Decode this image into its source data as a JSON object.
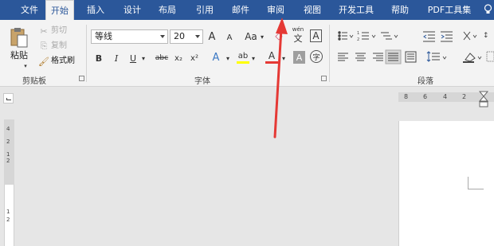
{
  "tabs": [
    "文件",
    "开始",
    "插入",
    "设计",
    "布局",
    "引用",
    "邮件",
    "审阅",
    "视图",
    "开发工具",
    "帮助",
    "PDF工具集"
  ],
  "active_tab": "开始",
  "clipboard": {
    "paste": "粘贴",
    "cut": "剪切",
    "copy": "复制",
    "format_painter": "格式刷",
    "group_label": "剪贴板"
  },
  "font": {
    "font_name": "等线",
    "font_size": "20",
    "group_label": "字体",
    "grow": "A",
    "shrink": "A",
    "case": "Aa",
    "bold": "B",
    "italic": "I",
    "underline": "U",
    "strike": "abc",
    "subscript": "x₂",
    "superscript": "x²",
    "effects": "A",
    "highlight": "ab",
    "font_color": "A",
    "char_shading": "A",
    "enclose": "字",
    "phonetic": "wén",
    "phonetic_char": "文",
    "border_char": "A"
  },
  "paragraph": {
    "group_label": "段落"
  },
  "ruler": {
    "numbers": [
      "8",
      "6",
      "4",
      "2"
    ],
    "vertical_numbers": [
      "4",
      "2",
      "1",
      "2",
      "1",
      "2"
    ]
  },
  "colors": {
    "tab_bar": "#2b579a",
    "ribbon": "#f3f3f3",
    "annotation_arrow": "#e53935",
    "font_color_bar": "#e53935",
    "highlight_bar": "#ffff00"
  }
}
